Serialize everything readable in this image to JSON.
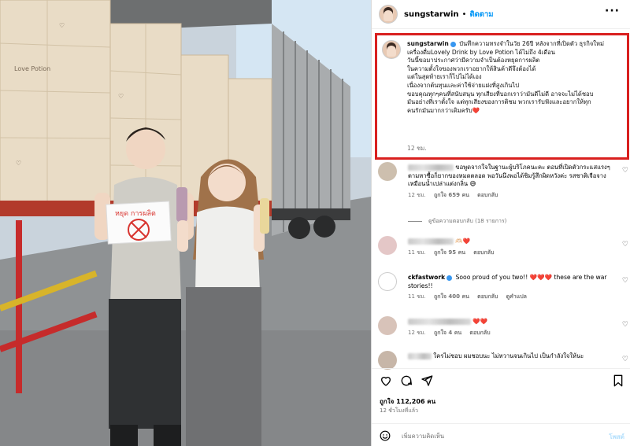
{
  "photo": {
    "alt": "Two people holding bottles in front of a truck loaded with boxes",
    "sign_text": "หยุด การผลิต",
    "box_text": "Love Potion"
  },
  "header": {
    "username": "sungstarwin",
    "separator": "•",
    "follow_label": "ติดตาม",
    "more_icon": "more-horizontal-icon"
  },
  "caption": {
    "username": "sungstarwin",
    "lines": [
      "บันทึกความทรงจำในวัย 26ปี หลังจากที่เปิดตัว ธุรกิจใหม่",
      "เครื่องดื่มLovely Drink by Love Potion ได้ไม่ถึง 4เดือน",
      "วันนี้ขอมาประกาศว่ามีความจำเป็นต้องหยุดการผลิต",
      "ในความตั้งใจของพวกเราอยากให้สินค้าดีจึงต้องได้",
      "แต่ในสุดท้ายเราก็ไปไม่ได้เอง",
      "เนื่องจากต้นทุนและค่าใช้จ่ายแฝงที่สูงเกินไป",
      "",
      "ขอบคุณทุกๆคนที่สนับสนุน ทุกเสียงที่บอกเราว่ามันดีไม่ดี อาจจะไม่ได้ชอบ",
      "มันอย่างที่เราตั้งใจ แต่ทุกเสียงของการติชม พวกเรารับฟังและอยากให้ทุก",
      "คนรักมันมากกว่าเดิมครับ"
    ],
    "heart": "❤️",
    "time": "12 ชม."
  },
  "comments": [
    {
      "text": "ขอพูดจากใจในฐานะผู้บริโภคนะคะ ตอนที่เปิดตัวกระแสแรงๆตามหาซื้อก็ยากของหมดตลอด พอวันนึงพอได้ชิมรู้สึกผิดหวังค่ะ รสชาติเจือจางเหมือนน้ำเปล่าแต่งกลิ่น",
      "emoji": "😅",
      "time": "12 ชม.",
      "likes": "ถูกใจ 659 คน",
      "reply": "ตอบกลับ",
      "replies": "ดูข้อความตอบกลับ (18 รายการ)"
    },
    {
      "text": "",
      "emoji": "🫶🏻❤️",
      "time": "11 ชม.",
      "likes": "ถูกใจ 95 คน",
      "reply": "ตอบกลับ"
    },
    {
      "username": "ckfastwork",
      "text": "Sooo proud of you two!!",
      "emoji": "❤️❤️❤️",
      "text2": "these are the war stories!!",
      "time": "11 ชม.",
      "likes": "ถูกใจ 400 คน",
      "reply": "ตอบกลับ",
      "translate": "ดูคำแปล"
    },
    {
      "text": "",
      "emoji": "❤️❤️",
      "time": "12 ชม.",
      "likes": "ถูกใจ 4 คน",
      "reply": "ตอบกลับ"
    },
    {
      "text": "ใครไม่ชอบ ผมชอบนะ ไม่หวานจนเกินไป เป็นกำลังใจให้นะ",
      "emoji": "",
      "time": "",
      "likes": "",
      "reply": ""
    }
  ],
  "actions": {
    "like_icon": "heart-outline-icon",
    "comment_icon": "comment-icon",
    "share_icon": "share-icon",
    "save_icon": "bookmark-icon"
  },
  "likes_total": "ถูกใจ 112,206 คน",
  "posted_ago": "12 ชั่วโมงที่แล้ว",
  "add_comment": {
    "placeholder": "เพิ่มความคิดเห็น",
    "post_label": "โพสต์"
  },
  "colors": {
    "link_blue": "#0095f6",
    "highlight_red": "#d9201f",
    "like_red": "#ed4956"
  }
}
